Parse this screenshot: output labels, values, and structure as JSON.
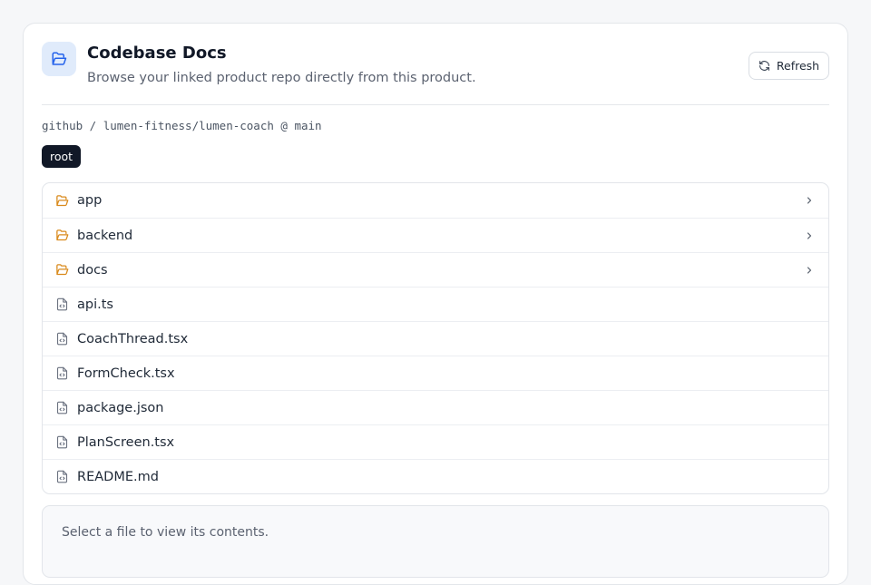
{
  "header": {
    "title": "Codebase Docs",
    "subtitle": "Browse your linked product repo directly from this product.",
    "icon": "folder-open-icon",
    "refresh_label": "Refresh",
    "refresh_icon": "refresh-icon"
  },
  "repo": {
    "path": "github / lumen-fitness/lumen-coach @ main"
  },
  "breadcrumb": {
    "root_label": "root"
  },
  "files": [
    {
      "name": "app",
      "kind": "folder"
    },
    {
      "name": "backend",
      "kind": "folder"
    },
    {
      "name": "docs",
      "kind": "folder"
    },
    {
      "name": "api.ts",
      "kind": "file"
    },
    {
      "name": "CoachThread.tsx",
      "kind": "file"
    },
    {
      "name": "FormCheck.tsx",
      "kind": "file"
    },
    {
      "name": "package.json",
      "kind": "file"
    },
    {
      "name": "PlanScreen.tsx",
      "kind": "file"
    },
    {
      "name": "README.md",
      "kind": "file"
    }
  ],
  "preview": {
    "placeholder": "Select a file to view its contents."
  },
  "colors": {
    "folder": "#d98a1c",
    "file_icon": "#6b7280",
    "accent_icon": "#2563eb",
    "icon_bg": "#e0ebfb",
    "crumb_bg": "#111827"
  }
}
